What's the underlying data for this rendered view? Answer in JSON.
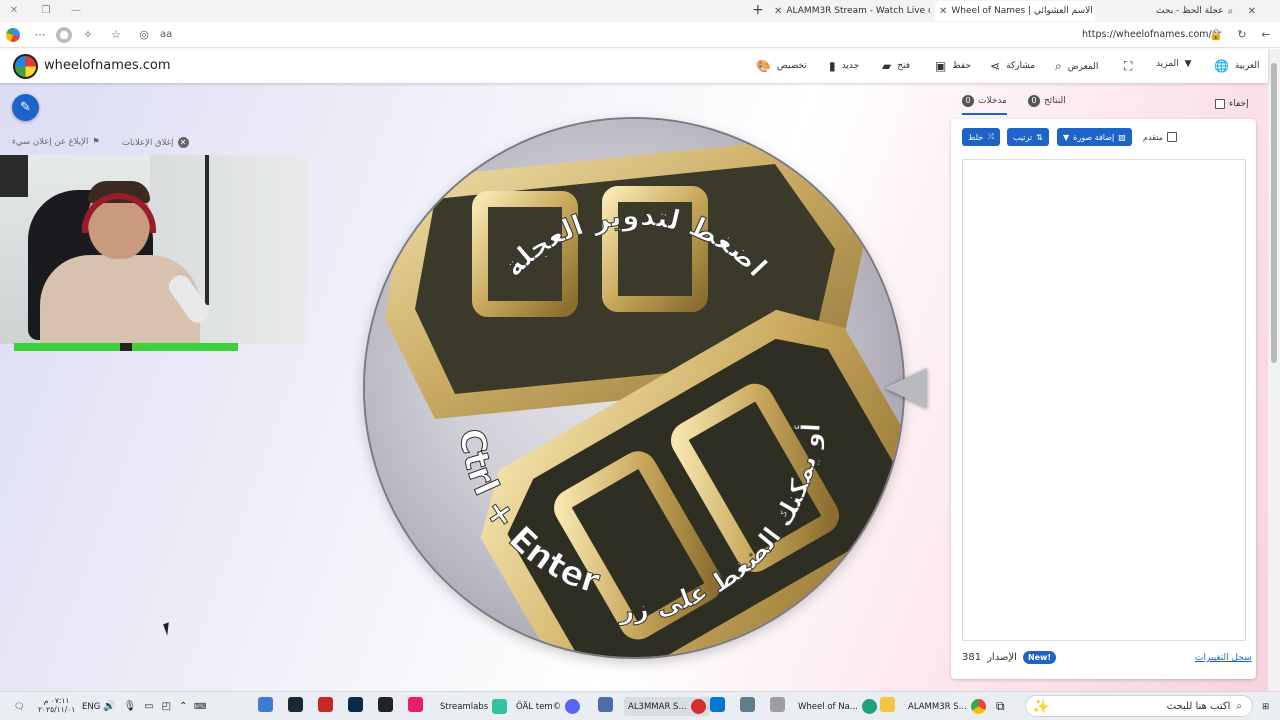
{
  "browser": {
    "tabs": [
      {
        "title": "عجلة الحظ - بحث"
      },
      {
        "title": "Wheel of Names | الاسم العشوائي"
      },
      {
        "title": "ALAMM3R Stream - Watch Live o"
      }
    ],
    "url": "https://wheelofnames.com/ar",
    "zoom_glyph": "aa"
  },
  "header": {
    "site_name": "wheelofnames.com",
    "nav": {
      "customize": "تخصيص",
      "new": "جديد",
      "open": "فتح",
      "save": "حفظ",
      "share": "مشاركة",
      "gallery": "المعرض",
      "more": "المزيد",
      "language": "العربية"
    }
  },
  "ads": {
    "report": "الإبلاغ عن إعلان سيء",
    "close": "إغلاق الإعلانات"
  },
  "wheel": {
    "line1": "اضغط لتدوير العجلة",
    "line2": "أو يمكنك الضغط على زر",
    "line3": "Ctrl + Enter"
  },
  "panel": {
    "hide_label": "إخفاء",
    "tabs": [
      {
        "label": "مدخلات",
        "count": "0"
      },
      {
        "label": "النتائج",
        "count": "0"
      }
    ],
    "buttons": {
      "shuffle": "خلط",
      "sort": "ترتيب",
      "add_image": "إضافة صورة"
    },
    "advanced": "متقدم",
    "version_label": "الإصدار",
    "version_number": "381",
    "new_badge": "New!",
    "changelog": "سجل التغييرات"
  },
  "taskbar": {
    "language": "ENG",
    "time": "٠٧:١١ م",
    "date": "٢٠٢٥/١١/٠١",
    "items": [
      {
        "label": "Streamlabs"
      },
      {
        "label": "ÖÄL tem©"
      },
      {
        "label": "AL3MMAR S..."
      },
      {
        "label": "Wheel of Na..."
      },
      {
        "label": "ALAMM3R S..."
      }
    ],
    "search_placeholder": "اكتب هنا للبحث"
  },
  "colors": {
    "accent": "#1e63c8",
    "green_bar": "#3bd13b"
  }
}
